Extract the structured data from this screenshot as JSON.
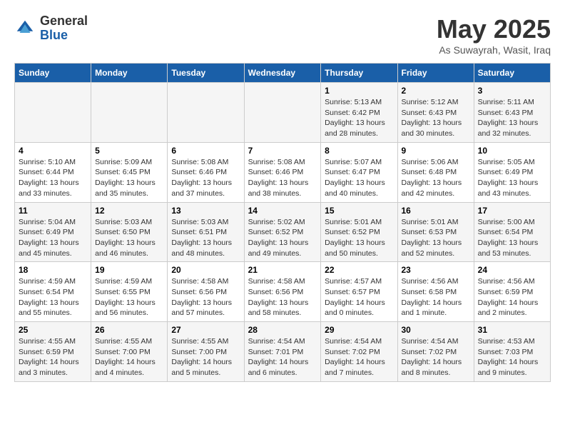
{
  "logo": {
    "general": "General",
    "blue": "Blue"
  },
  "title": "May 2025",
  "location": "As Suwayrah, Wasit, Iraq",
  "days_of_week": [
    "Sunday",
    "Monday",
    "Tuesday",
    "Wednesday",
    "Thursday",
    "Friday",
    "Saturday"
  ],
  "weeks": [
    [
      {
        "day": "",
        "info": ""
      },
      {
        "day": "",
        "info": ""
      },
      {
        "day": "",
        "info": ""
      },
      {
        "day": "",
        "info": ""
      },
      {
        "day": "1",
        "info": "Sunrise: 5:13 AM\nSunset: 6:42 PM\nDaylight: 13 hours and 28 minutes."
      },
      {
        "day": "2",
        "info": "Sunrise: 5:12 AM\nSunset: 6:43 PM\nDaylight: 13 hours and 30 minutes."
      },
      {
        "day": "3",
        "info": "Sunrise: 5:11 AM\nSunset: 6:43 PM\nDaylight: 13 hours and 32 minutes."
      }
    ],
    [
      {
        "day": "4",
        "info": "Sunrise: 5:10 AM\nSunset: 6:44 PM\nDaylight: 13 hours and 33 minutes."
      },
      {
        "day": "5",
        "info": "Sunrise: 5:09 AM\nSunset: 6:45 PM\nDaylight: 13 hours and 35 minutes."
      },
      {
        "day": "6",
        "info": "Sunrise: 5:08 AM\nSunset: 6:46 PM\nDaylight: 13 hours and 37 minutes."
      },
      {
        "day": "7",
        "info": "Sunrise: 5:08 AM\nSunset: 6:46 PM\nDaylight: 13 hours and 38 minutes."
      },
      {
        "day": "8",
        "info": "Sunrise: 5:07 AM\nSunset: 6:47 PM\nDaylight: 13 hours and 40 minutes."
      },
      {
        "day": "9",
        "info": "Sunrise: 5:06 AM\nSunset: 6:48 PM\nDaylight: 13 hours and 42 minutes."
      },
      {
        "day": "10",
        "info": "Sunrise: 5:05 AM\nSunset: 6:49 PM\nDaylight: 13 hours and 43 minutes."
      }
    ],
    [
      {
        "day": "11",
        "info": "Sunrise: 5:04 AM\nSunset: 6:49 PM\nDaylight: 13 hours and 45 minutes."
      },
      {
        "day": "12",
        "info": "Sunrise: 5:03 AM\nSunset: 6:50 PM\nDaylight: 13 hours and 46 minutes."
      },
      {
        "day": "13",
        "info": "Sunrise: 5:03 AM\nSunset: 6:51 PM\nDaylight: 13 hours and 48 minutes."
      },
      {
        "day": "14",
        "info": "Sunrise: 5:02 AM\nSunset: 6:52 PM\nDaylight: 13 hours and 49 minutes."
      },
      {
        "day": "15",
        "info": "Sunrise: 5:01 AM\nSunset: 6:52 PM\nDaylight: 13 hours and 50 minutes."
      },
      {
        "day": "16",
        "info": "Sunrise: 5:01 AM\nSunset: 6:53 PM\nDaylight: 13 hours and 52 minutes."
      },
      {
        "day": "17",
        "info": "Sunrise: 5:00 AM\nSunset: 6:54 PM\nDaylight: 13 hours and 53 minutes."
      }
    ],
    [
      {
        "day": "18",
        "info": "Sunrise: 4:59 AM\nSunset: 6:54 PM\nDaylight: 13 hours and 55 minutes."
      },
      {
        "day": "19",
        "info": "Sunrise: 4:59 AM\nSunset: 6:55 PM\nDaylight: 13 hours and 56 minutes."
      },
      {
        "day": "20",
        "info": "Sunrise: 4:58 AM\nSunset: 6:56 PM\nDaylight: 13 hours and 57 minutes."
      },
      {
        "day": "21",
        "info": "Sunrise: 4:58 AM\nSunset: 6:56 PM\nDaylight: 13 hours and 58 minutes."
      },
      {
        "day": "22",
        "info": "Sunrise: 4:57 AM\nSunset: 6:57 PM\nDaylight: 14 hours and 0 minutes."
      },
      {
        "day": "23",
        "info": "Sunrise: 4:56 AM\nSunset: 6:58 PM\nDaylight: 14 hours and 1 minute."
      },
      {
        "day": "24",
        "info": "Sunrise: 4:56 AM\nSunset: 6:59 PM\nDaylight: 14 hours and 2 minutes."
      }
    ],
    [
      {
        "day": "25",
        "info": "Sunrise: 4:55 AM\nSunset: 6:59 PM\nDaylight: 14 hours and 3 minutes."
      },
      {
        "day": "26",
        "info": "Sunrise: 4:55 AM\nSunset: 7:00 PM\nDaylight: 14 hours and 4 minutes."
      },
      {
        "day": "27",
        "info": "Sunrise: 4:55 AM\nSunset: 7:00 PM\nDaylight: 14 hours and 5 minutes."
      },
      {
        "day": "28",
        "info": "Sunrise: 4:54 AM\nSunset: 7:01 PM\nDaylight: 14 hours and 6 minutes."
      },
      {
        "day": "29",
        "info": "Sunrise: 4:54 AM\nSunset: 7:02 PM\nDaylight: 14 hours and 7 minutes."
      },
      {
        "day": "30",
        "info": "Sunrise: 4:54 AM\nSunset: 7:02 PM\nDaylight: 14 hours and 8 minutes."
      },
      {
        "day": "31",
        "info": "Sunrise: 4:53 AM\nSunset: 7:03 PM\nDaylight: 14 hours and 9 minutes."
      }
    ]
  ]
}
